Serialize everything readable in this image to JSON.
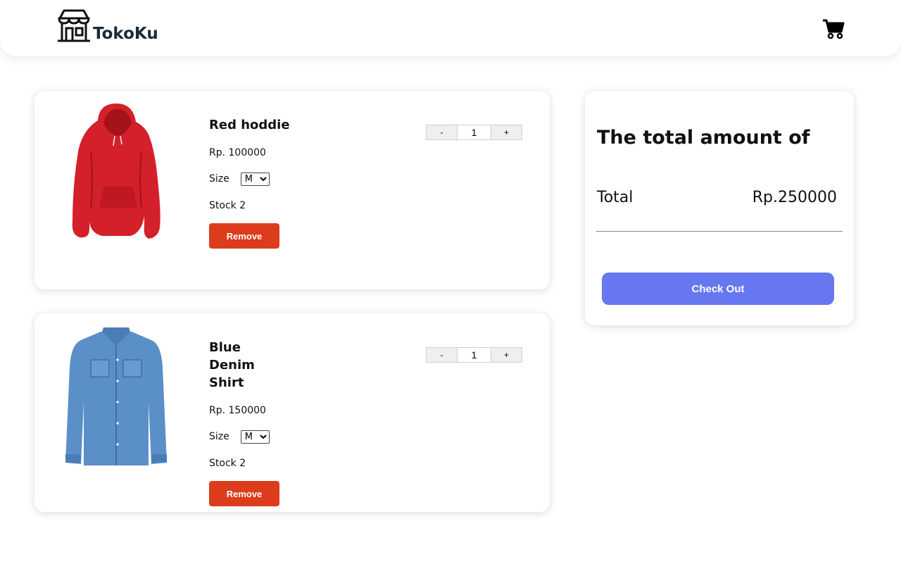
{
  "brand": {
    "name": "TokoKu",
    "icon": "store-icon"
  },
  "header": {
    "cart_icon": "shopping-cart-icon"
  },
  "cart": {
    "items": [
      {
        "name": "Red hoddie",
        "price": "Rp. 100000",
        "size_label": "Size",
        "size_value": "M",
        "stock": "Stock 2",
        "quantity": "1",
        "remove_label": "Remove",
        "minus_label": "-",
        "plus_label": "+",
        "image": "red-hoodie-image",
        "color": "#d3202a"
      },
      {
        "name": "Blue Denim Shirt",
        "price": "Rp. 150000",
        "size_label": "Size",
        "size_value": "M",
        "stock": "Stock 2",
        "quantity": "1",
        "remove_label": "Remove",
        "minus_label": "-",
        "plus_label": "+",
        "image": "denim-shirt-image",
        "color": "#5b8fc7"
      }
    ]
  },
  "summary": {
    "title": "The total amount of",
    "total_label": "Total",
    "total_value": "Rp.250000",
    "checkout_label": "Check Out"
  },
  "colors": {
    "remove": "#dc3c1c",
    "checkout": "#6777f0",
    "brand_text": "#1a2a3a"
  }
}
